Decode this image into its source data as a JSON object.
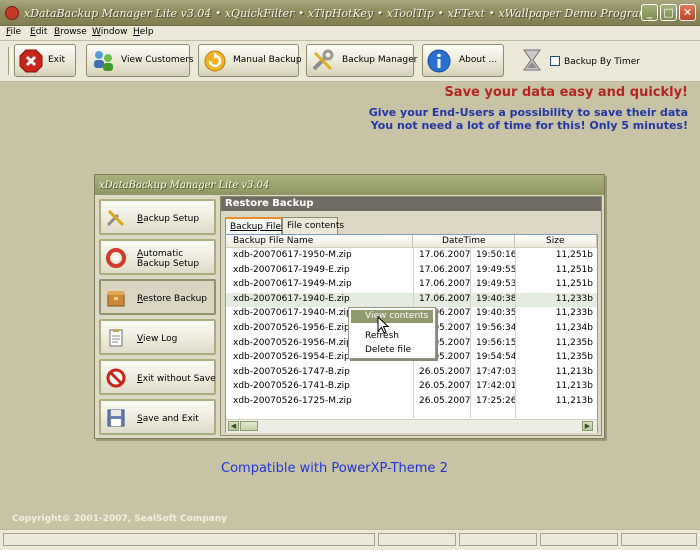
{
  "window": {
    "title": "xDataBackup Manager Lite v3.04 • xQuickFilter • xTipHotKey • xToolTip • xFText • xWallpaper Demo Program",
    "minimize_label": "_",
    "maximize_label": "□",
    "close_label": "✕"
  },
  "menu": [
    "File",
    "Edit",
    "Browse",
    "Window",
    "Help"
  ],
  "toolbar": {
    "buttons": [
      {
        "label": "Exit",
        "icon": "exit-icon"
      },
      {
        "label": "View Customers",
        "icon": "customers-icon"
      },
      {
        "label": "Manual Backup",
        "icon": "backup-icon"
      },
      {
        "label": "Backup Manager",
        "icon": "tools-icon"
      },
      {
        "label": "About ...",
        "icon": "info-icon"
      }
    ],
    "timer_checkbox_label": "Backup By Timer",
    "timer_checked": false
  },
  "slogans": {
    "line1": "Save your data easy and quickly!",
    "line2": "Give your End-Users a possibility to save their data",
    "line3": "You not need a lot of time for this! Only 5 minutes!"
  },
  "child_window": {
    "title": "xDataBackup Manager Lite v3.04",
    "side_buttons": [
      {
        "label": "Backup Setup",
        "icon": "setup-icon"
      },
      {
        "label": "Automatic Backup Setup",
        "icon": "auto-backup-icon"
      },
      {
        "label": "Restore Backup",
        "icon": "restore-icon",
        "active": true
      },
      {
        "label": "View Log",
        "icon": "log-icon"
      },
      {
        "label": "Exit without Save",
        "icon": "no-save-icon"
      },
      {
        "label": "Save and Exit",
        "icon": "save-icon"
      }
    ],
    "panel_title": "Restore Backup",
    "tabs": [
      "Backup Files",
      "File contents"
    ],
    "active_tab": 0,
    "columns": {
      "name": "Backup File Name",
      "datetime": "DateTime",
      "size": "Size"
    },
    "rows": [
      {
        "name": "xdb-20070617-1950-M.zip",
        "date": "17.06.2007",
        "time": "19:50:16",
        "size": "11,251b"
      },
      {
        "name": "xdb-20070617-1949-E.zip",
        "date": "17.06.2007",
        "time": "19:49:55",
        "size": "11,251b"
      },
      {
        "name": "xdb-20070617-1949-M.zip",
        "date": "17.06.2007",
        "time": "19:49:53",
        "size": "11,251b"
      },
      {
        "name": "xdb-20070617-1940-E.zip",
        "date": "17.06.2007",
        "time": "19:40:38",
        "size": "11,233b",
        "selected": true
      },
      {
        "name": "xdb-20070617-1940-M.zip",
        "date": "17.06.2007",
        "time": "19:40:35",
        "size": "11,233b"
      },
      {
        "name": "xdb-20070526-1956-E.zip",
        "date": "26.05.2007",
        "time": "19:56:34",
        "size": "11,234b"
      },
      {
        "name": "xdb-20070526-1956-M.zip",
        "date": "26.05.2007",
        "time": "19:56:15",
        "size": "11,235b"
      },
      {
        "name": "xdb-20070526-1954-E.zip",
        "date": "26.05.2007",
        "time": "19:54:54",
        "size": "11,235b"
      },
      {
        "name": "xdb-20070526-1747-B.zip",
        "date": "26.05.2007",
        "time": "17:47:03",
        "size": "11,213b"
      },
      {
        "name": "xdb-20070526-1741-B.zip",
        "date": "26.05.2007",
        "time": "17:42:01",
        "size": "11,213b"
      },
      {
        "name": "xdb-20070526-1725-M.zip",
        "date": "26.05.2007",
        "time": "17:25:26",
        "size": "11,213b"
      }
    ],
    "context_menu": [
      "View contents",
      "Refresh",
      "Delete file"
    ]
  },
  "compat_text": "Compatible with PowerXP-Theme 2",
  "copyright": "Copyright© 2001-2007, SealSoft Company",
  "colors": {
    "slogan_red": "#b3261e",
    "slogan_blue": "#2136a6",
    "compat_blue": "#1f34d8",
    "background": "#c9c3a6"
  }
}
